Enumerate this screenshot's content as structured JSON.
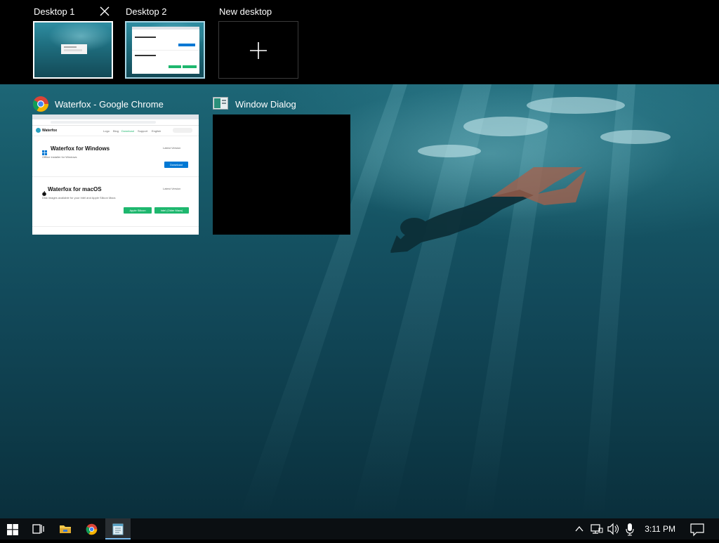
{
  "desktops": [
    {
      "label": "Desktop 1",
      "close_icon": "close-icon",
      "state": "hover"
    },
    {
      "label": "Desktop 2",
      "state": "current"
    },
    {
      "label": "New desktop",
      "icon": "plus-icon"
    }
  ],
  "windows": [
    {
      "title": "Waterfox - Google Chrome",
      "icon": "chrome-icon",
      "page": {
        "brand": "Waterfox",
        "nav": [
          "Logo",
          "Blog",
          "Download",
          "Support",
          "English"
        ],
        "sections": [
          {
            "heading": "Waterfox for Windows",
            "subtitle": "Offline installer for Windows",
            "version_label": "Latest Version",
            "button": "Download"
          },
          {
            "heading": "Waterfox for macOS",
            "subtitle": "Disk images available for your Intel and Apple Silicon Macs",
            "version_label": "Latest Version",
            "buttons": [
              "Apple Silicon",
              "Intel (Older Macs)"
            ]
          }
        ]
      }
    },
    {
      "title": "Window Dialog",
      "icon": "window-dialog-icon"
    }
  ],
  "taskbar": {
    "items": [
      {
        "name": "start-button",
        "icon": "windows-logo-icon"
      },
      {
        "name": "task-view-button",
        "icon": "task-view-icon"
      },
      {
        "name": "file-explorer-button",
        "icon": "folder-icon"
      },
      {
        "name": "chrome-button",
        "icon": "chrome-icon"
      },
      {
        "name": "notepad-button",
        "icon": "notepad-icon",
        "active": true
      }
    ],
    "tray": {
      "icons": [
        "chevron-up-icon",
        "network-icon",
        "volume-icon",
        "microphone-icon"
      ],
      "time": "3:11 PM",
      "notification_icon": "action-center-icon"
    }
  },
  "colors": {
    "accent_current_border": "#a9d6e5",
    "taskbar_bg": "#0b0f12",
    "download_button": "#0078d4",
    "mac_button": "#1eb76e"
  }
}
